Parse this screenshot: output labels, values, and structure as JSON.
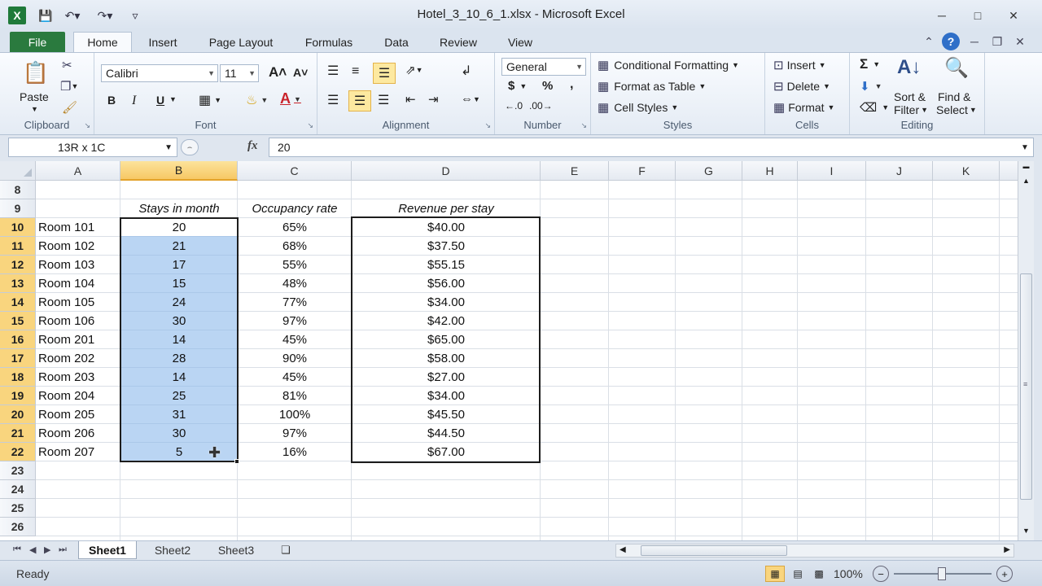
{
  "window": {
    "title": "Hotel_3_10_6_1.xlsx - Microsoft Excel",
    "app_icon_letter": "X"
  },
  "tabs": [
    {
      "label": "File"
    },
    {
      "label": "Home"
    },
    {
      "label": "Insert"
    },
    {
      "label": "Page Layout"
    },
    {
      "label": "Formulas"
    },
    {
      "label": "Data"
    },
    {
      "label": "Review"
    },
    {
      "label": "View"
    }
  ],
  "ribbon": {
    "clipboard": {
      "label": "Clipboard",
      "paste": "Paste"
    },
    "font": {
      "label": "Font",
      "name": "Calibri",
      "size": "11",
      "bold": "B",
      "italic": "I",
      "underline": "U"
    },
    "alignment": {
      "label": "Alignment"
    },
    "number": {
      "label": "Number",
      "format": "General",
      "currency": "$",
      "percent": "%",
      "comma": ","
    },
    "styles": {
      "label": "Styles",
      "conditional": "Conditional Formatting",
      "format_table": "Format as Table",
      "cell_styles": "Cell Styles"
    },
    "cells": {
      "label": "Cells",
      "insert": "Insert",
      "delete": "Delete",
      "format": "Format"
    },
    "editing": {
      "label": "Editing",
      "sort_l1": "Sort &",
      "sort_l2": "Filter",
      "find_l1": "Find &",
      "find_l2": "Select"
    }
  },
  "formula_bar": {
    "name_box": "13R x 1C",
    "fx": "fx",
    "value": "20"
  },
  "columns": [
    "A",
    "B",
    "C",
    "D",
    "E",
    "F",
    "G",
    "H",
    "I",
    "J",
    "K"
  ],
  "rows": [
    "8",
    "9",
    "10",
    "11",
    "12",
    "13",
    "14",
    "15",
    "16",
    "17",
    "18",
    "19",
    "20",
    "21",
    "22",
    "23",
    "24",
    "25",
    "26"
  ],
  "table": {
    "headers": {
      "b": "Stays in month",
      "c": "Occupancy rate",
      "d": "Revenue per stay"
    },
    "data": [
      {
        "room": "Room 101",
        "stays": "20",
        "occ": "65%",
        "rev": "$40.00"
      },
      {
        "room": "Room 102",
        "stays": "21",
        "occ": "68%",
        "rev": "$37.50"
      },
      {
        "room": "Room 103",
        "stays": "17",
        "occ": "55%",
        "rev": "$55.15"
      },
      {
        "room": "Room 104",
        "stays": "15",
        "occ": "48%",
        "rev": "$56.00"
      },
      {
        "room": "Room 105",
        "stays": "24",
        "occ": "77%",
        "rev": "$34.00"
      },
      {
        "room": "Room 106",
        "stays": "30",
        "occ": "97%",
        "rev": "$42.00"
      },
      {
        "room": "Room 201",
        "stays": "14",
        "occ": "45%",
        "rev": "$65.00"
      },
      {
        "room": "Room 202",
        "stays": "28",
        "occ": "90%",
        "rev": "$58.00"
      },
      {
        "room": "Room 203",
        "stays": "14",
        "occ": "45%",
        "rev": "$27.00"
      },
      {
        "room": "Room 204",
        "stays": "25",
        "occ": "81%",
        "rev": "$34.00"
      },
      {
        "room": "Room 205",
        "stays": "31",
        "occ": "100%",
        "rev": "$45.50"
      },
      {
        "room": "Room 206",
        "stays": "30",
        "occ": "97%",
        "rev": "$44.50"
      },
      {
        "room": "Room 207",
        "stays": "5",
        "occ": "16%",
        "rev": "$67.00"
      }
    ]
  },
  "sheets": [
    {
      "label": "Sheet1"
    },
    {
      "label": "Sheet2"
    },
    {
      "label": "Sheet3"
    }
  ],
  "status": {
    "ready": "Ready",
    "zoom": "100%"
  },
  "colors": {
    "file_tab": "#2a7a3e",
    "selection": "#8cb9eb",
    "header_highlight": "#f7c865"
  }
}
